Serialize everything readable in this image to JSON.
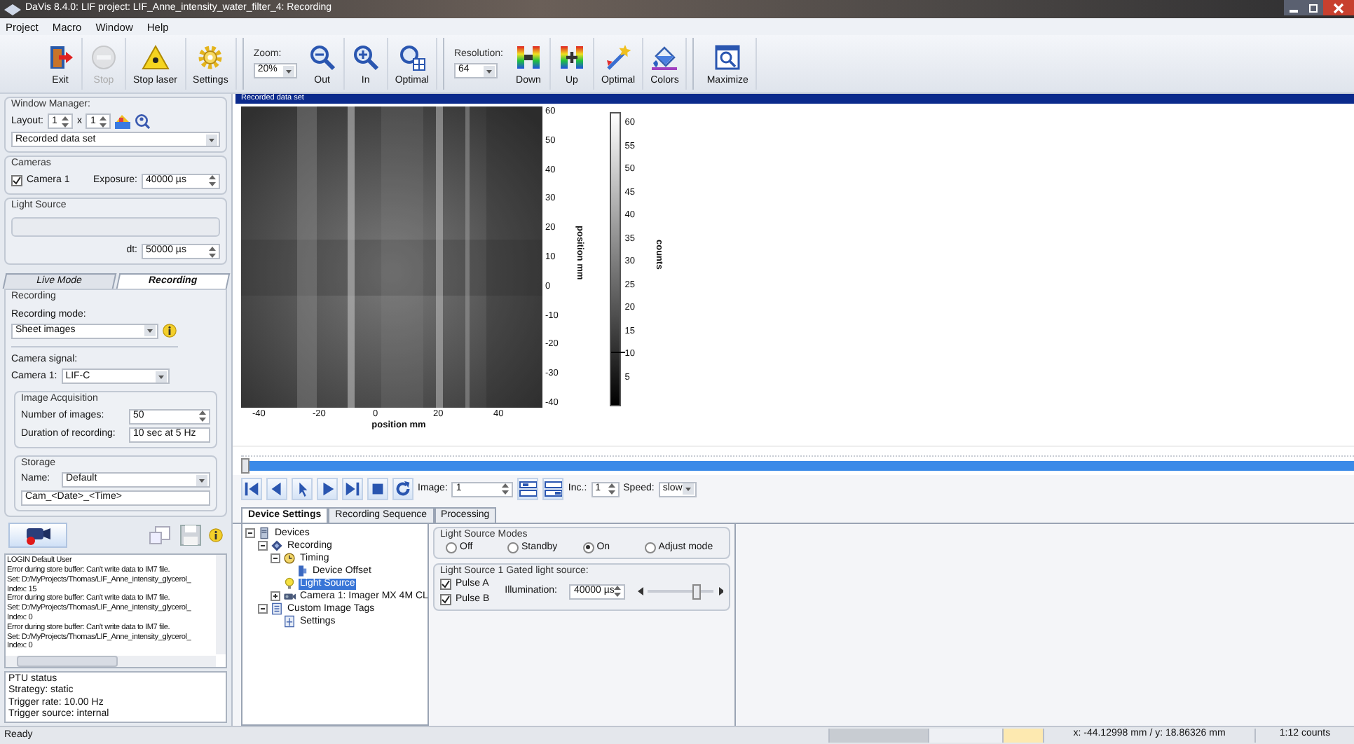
{
  "window": {
    "title": "DaVis 8.4.0: LIF project: LIF_Anne_intensity_water_filter_4: Recording"
  },
  "menu": [
    "Project",
    "Macro",
    "Window",
    "Help"
  ],
  "toolbar": [
    {
      "kind": "button",
      "label": "Exit",
      "disabled": false
    },
    {
      "kind": "button",
      "label": "Stop",
      "disabled": true
    },
    {
      "kind": "button",
      "label": "Stop laser",
      "disabled": false
    },
    {
      "kind": "button",
      "label": "Settings",
      "disabled": false
    },
    {
      "kind": "separator"
    },
    {
      "kind": "combo",
      "label": "Zoom:",
      "value": "20%"
    },
    {
      "kind": "button",
      "label": "Out",
      "disabled": false
    },
    {
      "kind": "button",
      "label": "In",
      "disabled": false
    },
    {
      "kind": "button",
      "label": "Optimal",
      "disabled": false
    },
    {
      "kind": "separator"
    },
    {
      "kind": "combo",
      "label": "Resolution:",
      "value": "64"
    },
    {
      "kind": "button",
      "label": "Down",
      "disabled": false
    },
    {
      "kind": "button",
      "label": "Up",
      "disabled": false
    },
    {
      "kind": "button",
      "label": "Optimal",
      "disabled": false
    },
    {
      "kind": "button",
      "label": "Colors",
      "disabled": false
    },
    {
      "kind": "separator"
    },
    {
      "kind": "button",
      "label": "Maximize",
      "disabled": false
    }
  ],
  "window_manager": {
    "title": "Window Manager:",
    "layout_label": "Layout:",
    "rows": "1",
    "times": "x",
    "cols": "1",
    "view": "Recorded data set"
  },
  "cameras": {
    "title": "Cameras",
    "camera": {
      "label": "Camera 1",
      "checked": true
    },
    "exposure_label": "Exposure:",
    "exposure": "40000 µs"
  },
  "light_source": {
    "title": "Light Source",
    "dt_label": "dt:",
    "dt": "50000 µs"
  },
  "mode_tabs": [
    {
      "label": "Live Mode",
      "selected": false
    },
    {
      "label": "Recording",
      "selected": true
    }
  ],
  "recording": {
    "title": "Recording",
    "mode_label": "Recording mode:",
    "mode": "Sheet images",
    "signal_label": "Camera signal:",
    "camera_label": "Camera 1:",
    "camera": "LIF-C",
    "acquisition": {
      "title": "Image Acquisition",
      "count_label": "Number of images:",
      "count": "50",
      "duration_label": "Duration of recording:",
      "duration": "10 sec at 5 Hz"
    },
    "storage": {
      "title": "Storage",
      "name_label": "Name:",
      "name": "Default",
      "pattern": "Cam_<Date>_<Time>"
    }
  },
  "log": [
    "LOGIN Default User",
    "Error during store buffer: Can't write data to IM7 file.",
    "Set: D:/MyProjects/Thomas/LIF_Anne_intensity_glycerol_",
    "Index: 15",
    "Error during store buffer: Can't write data to IM7 file.",
    "Set: D:/MyProjects/Thomas/LIF_Anne_intensity_glycerol_",
    "Index: 0",
    "Error during store buffer: Can't write data to IM7 file.",
    "Set: D:/MyProjects/Thomas/LIF_Anne_intensity_glycerol_",
    "Index: 0"
  ],
  "ptu_status": [
    "PTU status",
    "Strategy: static",
    "Trigger rate: 10.00 Hz",
    "Trigger source: internal"
  ],
  "view": {
    "title": "Recorded data set",
    "xlabel": "position mm",
    "ylabel": "position mm",
    "xticks": [
      "-40",
      "-20",
      "0",
      "20",
      "40"
    ],
    "yticks": [
      "60",
      "50",
      "40",
      "30",
      "20",
      "10",
      "0",
      "-10",
      "-20",
      "-30",
      "-40"
    ],
    "colorbar_label": "counts",
    "colorbar_ticks": [
      "60",
      "55",
      "50",
      "45",
      "40",
      "35",
      "30",
      "25",
      "20",
      "15",
      "10",
      "5"
    ]
  },
  "timeline": {
    "level": 0
  },
  "player": {
    "image_label": "Image:",
    "image": "1",
    "inc_label": "Inc.:",
    "inc": "1",
    "speed_label": "Speed:",
    "speed": "slow"
  },
  "tabs": [
    {
      "label": "Device Settings",
      "selected": true
    },
    {
      "label": "Recording Sequence",
      "selected": false
    },
    {
      "label": "Processing",
      "selected": false
    }
  ],
  "tree": [
    {
      "label": "Devices",
      "expanded": true,
      "selected": false,
      "children": [
        {
          "label": "Recording",
          "expanded": true,
          "selected": false,
          "children": [
            {
              "label": "Timing",
              "expanded": true,
              "selected": false,
              "children": [
                {
                  "label": "Device Offset",
                  "selected": false
                }
              ]
            },
            {
              "label": "Light Source",
              "selected": true
            },
            {
              "label": "Camera 1: Imager MX 4M CL",
              "expanded": false,
              "selected": false
            }
          ]
        },
        {
          "label": "Custom Image Tags",
          "expanded": true,
          "selected": false,
          "children": [
            {
              "label": "Settings",
              "selected": false
            }
          ]
        }
      ]
    }
  ],
  "light_modes": {
    "title": "Light Source Modes",
    "options": [
      {
        "label": "Off",
        "selected": false
      },
      {
        "label": "Standby",
        "selected": false
      },
      {
        "label": "On",
        "selected": true
      },
      {
        "label": "Adjust mode",
        "selected": false
      }
    ]
  },
  "gated": {
    "title": "Light Source 1 Gated light source:",
    "pulses": [
      {
        "label": "Pulse A",
        "checked": true
      },
      {
        "label": "Pulse B",
        "checked": true
      }
    ],
    "illumination_label": "Illumination:",
    "illumination": "40000 µs",
    "level": 0.75
  },
  "status_bar": {
    "text": "Ready",
    "coords": "x: -44.12998 mm / y: 18.86326 mm",
    "counts": "1:12 counts"
  }
}
